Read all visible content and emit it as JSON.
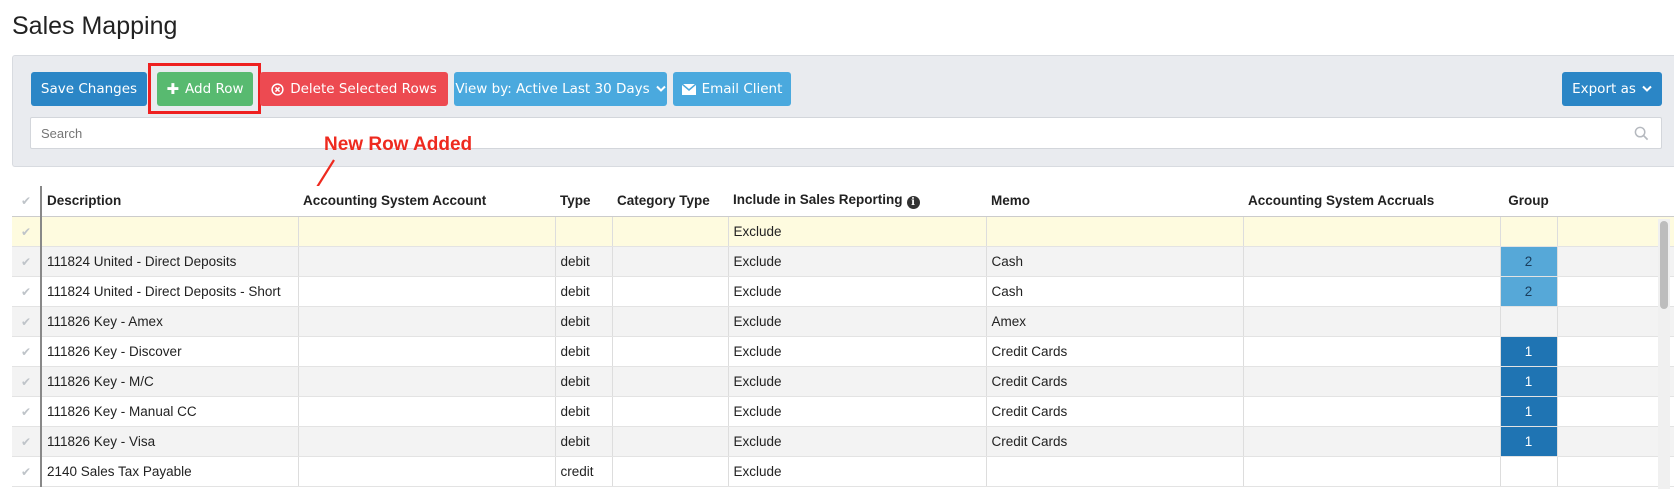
{
  "page": {
    "title": "Sales Mapping"
  },
  "toolbar": {
    "save_label": "Save Changes",
    "add_label": "Add Row",
    "delete_label": "Delete Selected Rows",
    "view_label": "View by: Active Last 30 Days",
    "email_label": "Email Client",
    "export_label": "Export as"
  },
  "search": {
    "placeholder": "Search"
  },
  "annotation": {
    "text": "New Row Added",
    "color": "#ee2a1f"
  },
  "table": {
    "headers": {
      "description": "Description",
      "account": "Accounting System Account",
      "type": "Type",
      "category": "Category Type",
      "include": "Include in Sales Reporting",
      "memo": "Memo",
      "accruals": "Accounting System Accruals",
      "group": "Group"
    },
    "rows": [
      {
        "description": "",
        "account": "",
        "type": "",
        "category": "",
        "include": "Exclude",
        "memo": "",
        "accruals": "",
        "group": ""
      },
      {
        "description": "111824 United - Direct Deposits",
        "account": "",
        "type": "debit",
        "category": "",
        "include": "Exclude",
        "memo": "Cash",
        "accruals": "",
        "group": "2"
      },
      {
        "description": "111824 United - Direct Deposits - Short",
        "account": "",
        "type": "debit",
        "category": "",
        "include": "Exclude",
        "memo": "Cash",
        "accruals": "",
        "group": "2"
      },
      {
        "description": "111826 Key - Amex",
        "account": "",
        "type": "debit",
        "category": "",
        "include": "Exclude",
        "memo": "Amex",
        "accruals": "",
        "group": ""
      },
      {
        "description": "111826 Key - Discover",
        "account": "",
        "type": "debit",
        "category": "",
        "include": "Exclude",
        "memo": "Credit Cards",
        "accruals": "",
        "group": "1"
      },
      {
        "description": "111826 Key - M/C",
        "account": "",
        "type": "debit",
        "category": "",
        "include": "Exclude",
        "memo": "Credit Cards",
        "accruals": "",
        "group": "1"
      },
      {
        "description": "111826 Key - Manual CC",
        "account": "",
        "type": "debit",
        "category": "",
        "include": "Exclude",
        "memo": "Credit Cards",
        "accruals": "",
        "group": "1"
      },
      {
        "description": "111826 Key - Visa",
        "account": "",
        "type": "debit",
        "category": "",
        "include": "Exclude",
        "memo": "Credit Cards",
        "accruals": "",
        "group": "1"
      },
      {
        "description": "2140 Sales Tax Payable",
        "account": "",
        "type": "credit",
        "category": "",
        "include": "Exclude",
        "memo": "",
        "accruals": "",
        "group": ""
      }
    ]
  },
  "colors": {
    "save": "#2b86c6",
    "add": "#58ba70",
    "delete": "#ed4a51",
    "view": "#4aa9de",
    "email": "#4aa9de",
    "export": "#2b86c6",
    "new_row_bg": "#fefbdf",
    "group_1": "#1f74b3",
    "group_2": "#56a8d8",
    "highlight_border": "#ee2020"
  }
}
